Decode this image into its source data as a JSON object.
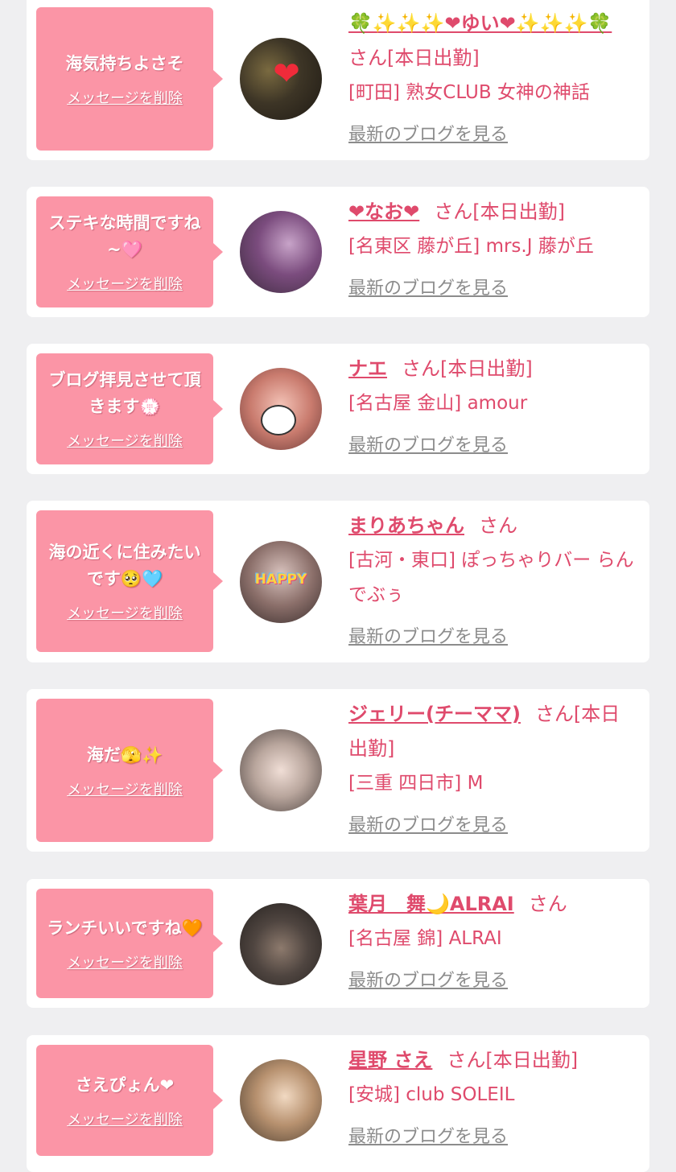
{
  "delete_label": "メッセージを削除",
  "blog_label": "最新のブログを見る",
  "san_suffix": "さん",
  "colors": {
    "background": "#efeff1",
    "bubble": "#fb95a6",
    "accent": "#df4a6c",
    "link_gray": "#8c8c8c"
  },
  "entries": [
    {
      "message": "海気持ちよさそ",
      "name": "🍀✨✨✨❤ゆい❤✨✨✨🍀",
      "status": "さん[本日出勤]",
      "shop": "[町田] 熟女CLUB 女神の神話"
    },
    {
      "message": "ステキな時間ですね~🩷",
      "name": "❤なお❤",
      "status": "さん[本日出勤]",
      "shop": "[名東区 藤が丘] mrs.J 藤が丘"
    },
    {
      "message": "ブログ拝見させて頂きます💮",
      "name": "ナエ",
      "status": "さん[本日出勤]",
      "shop": "[名古屋 金山] amour"
    },
    {
      "message": "海の近くに住みたいです🥺🩵",
      "name": "まりあちゃん",
      "status": "さん",
      "shop": "[古河・東口] ぽっちゃりバー らんでぶぅ"
    },
    {
      "message": "海だ🫣✨",
      "name": "ジェリー(チーママ)",
      "status": "さん[本日出勤]",
      "shop": "[三重 四日市] M"
    },
    {
      "message": "ランチいいですね🧡",
      "name": "葉月　舞🌙ALRAI",
      "status": "さん",
      "shop": "[名古屋 錦] ALRAI"
    },
    {
      "message": "さえぴょん❤",
      "name": "星野 さえ",
      "status": "さん[本日出勤]",
      "shop": "[安城] club SOLEIL"
    }
  ],
  "avatars": [
    {
      "icon": "heart-sticker",
      "glyph": "❤",
      "overlay_text": ""
    },
    {
      "icon": "photo",
      "glyph": "",
      "overlay_text": ""
    },
    {
      "icon": "bear-sticker",
      "glyph": "",
      "overlay_text": ""
    },
    {
      "icon": "happy-sticker",
      "glyph": "",
      "overlay_text": "HAPPY"
    },
    {
      "icon": "photo",
      "glyph": "",
      "overlay_text": ""
    },
    {
      "icon": "photo",
      "glyph": "",
      "overlay_text": ""
    },
    {
      "icon": "photo",
      "glyph": "",
      "overlay_text": ""
    }
  ]
}
